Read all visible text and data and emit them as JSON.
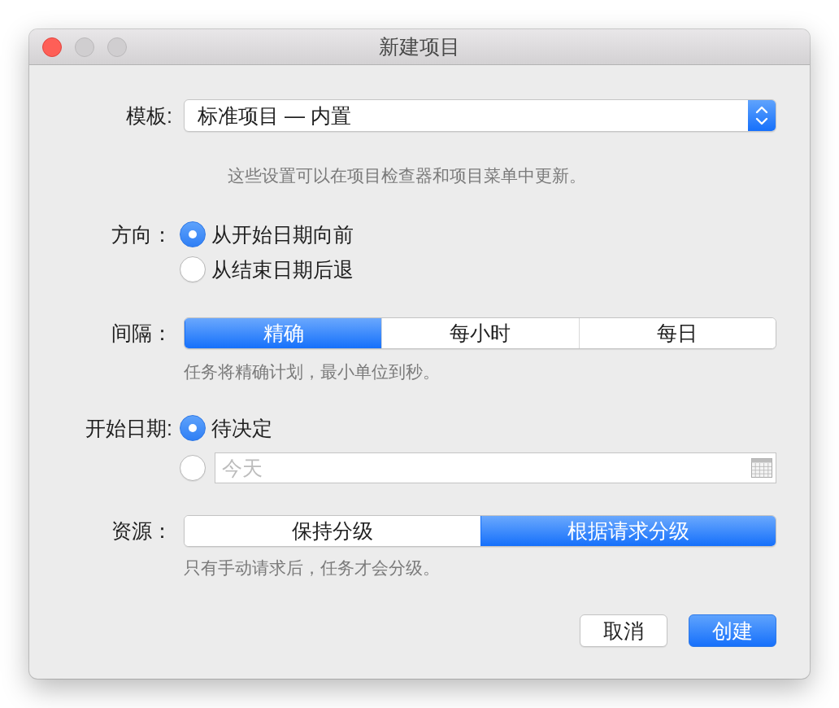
{
  "window": {
    "title": "新建项目",
    "buttons": [
      {
        "kind": "close",
        "disabled": false
      },
      {
        "kind": "minimize",
        "disabled": true
      },
      {
        "kind": "zoom",
        "disabled": true
      }
    ]
  },
  "template": {
    "label": "模板:",
    "value": "标准项目 — 内置",
    "note": "这些设置可以在项目检查器和项目菜单中更新。"
  },
  "direction": {
    "label": "方向：",
    "options": [
      {
        "label": "从开始日期向前",
        "selected": true
      },
      {
        "label": "从结束日期后退",
        "selected": false
      }
    ]
  },
  "interval": {
    "label": "间隔：",
    "segments": [
      {
        "label": "精确",
        "selected": true
      },
      {
        "label": "每小时",
        "selected": false
      },
      {
        "label": "每日",
        "selected": false
      }
    ],
    "note": "任务将精确计划，最小单位到秒。"
  },
  "start_date": {
    "label": "开始日期:",
    "options": [
      {
        "kind": "text",
        "label": "待决定",
        "selected": true
      },
      {
        "kind": "date_field",
        "placeholder": "今天",
        "selected": false
      }
    ]
  },
  "resources": {
    "label": "资源：",
    "segments": [
      {
        "label": "保持分级",
        "selected": false
      },
      {
        "label": "根据请求分级",
        "selected": true
      }
    ],
    "note": "只有手动请求后，任务才会分级。"
  },
  "buttons": [
    {
      "kind": "secondary",
      "label": "取消"
    },
    {
      "kind": "primary",
      "label": "创建"
    }
  ]
}
